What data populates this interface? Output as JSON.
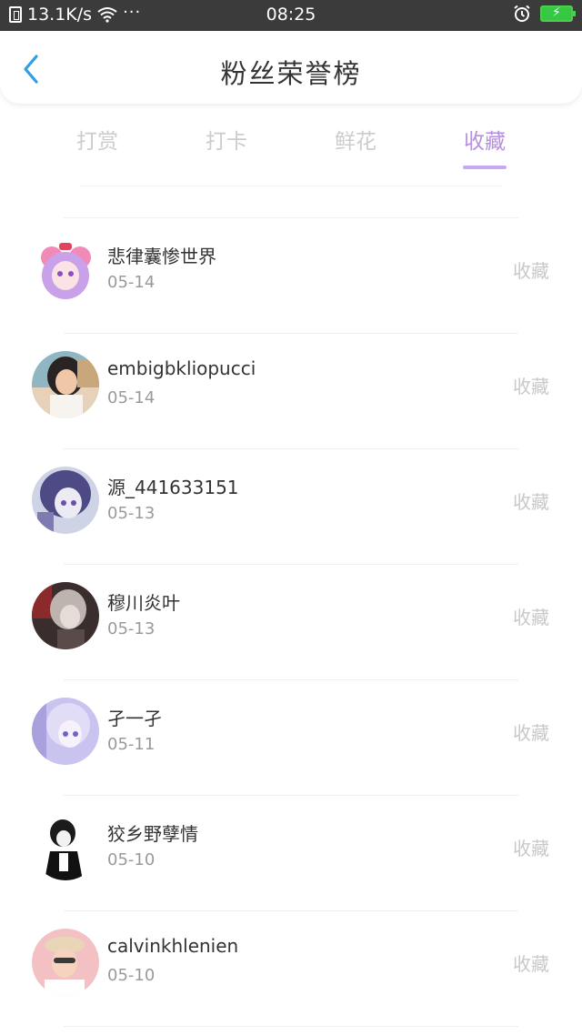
{
  "status_bar": {
    "network_speed": "13.1K/s",
    "more": "···",
    "time": "08:25",
    "icons": [
      "sim-icon",
      "wifi-icon",
      "alarm-icon",
      "battery-charging-icon"
    ]
  },
  "header": {
    "title": "粉丝荣誉榜",
    "back_icon": "chevron-left-icon"
  },
  "tabs": [
    {
      "label": "打赏",
      "active": false
    },
    {
      "label": "打卡",
      "active": false
    },
    {
      "label": "鲜花",
      "active": false
    },
    {
      "label": "收藏",
      "active": true
    }
  ],
  "colors": {
    "accent": "#b68fde",
    "indicator": "#c9a8ef",
    "back": "#2fa0e6"
  },
  "fans": [
    {
      "name": "悲律囊惨世界",
      "date": "05-14",
      "action": "收藏",
      "avatar": "anime-girl-pink-avatar"
    },
    {
      "name": "embigbkliopucci",
      "date": "05-14",
      "action": "收藏",
      "avatar": "photo-girl-avatar"
    },
    {
      "name": "源_441633151",
      "date": "05-13",
      "action": "收藏",
      "avatar": "anime-purple-avatar"
    },
    {
      "name": "穆川炎叶",
      "date": "05-13",
      "action": "收藏",
      "avatar": "dark-anime-avatar"
    },
    {
      "name": "孑一孑",
      "date": "05-11",
      "action": "收藏",
      "avatar": "anime-lilac-avatar"
    },
    {
      "name": "狡乡野孽情",
      "date": "05-10",
      "action": "收藏",
      "avatar": "sketch-boy-avatar"
    },
    {
      "name": "calvinkhlenien",
      "date": "05-10",
      "action": "收藏",
      "avatar": "photo-boy-avatar"
    }
  ]
}
